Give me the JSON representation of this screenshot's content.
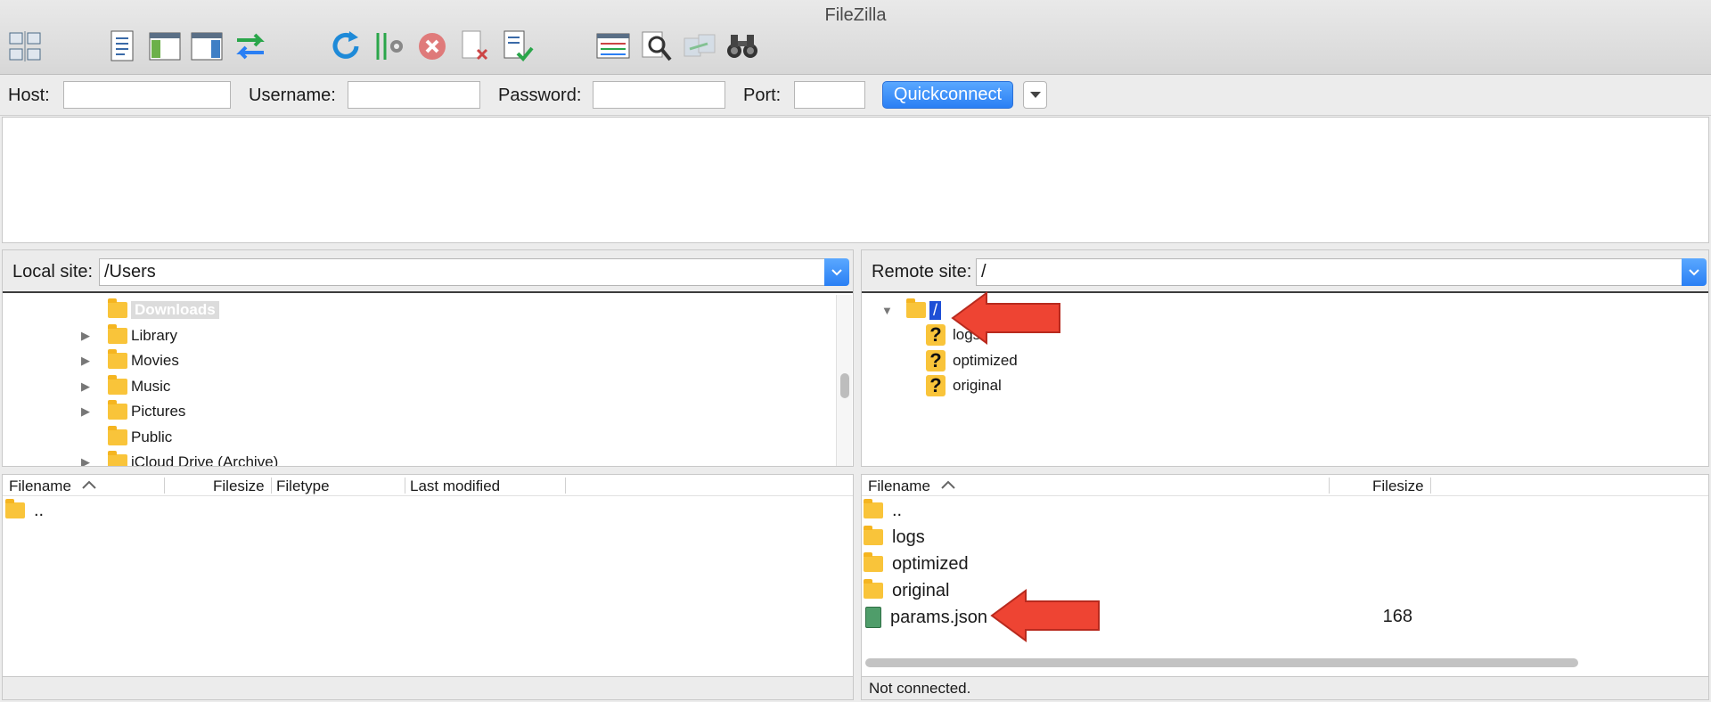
{
  "window": {
    "title": "FileZilla"
  },
  "toolbar": {
    "icons": [
      "site-manager-icon",
      "message-log-icon",
      "local-tree-icon",
      "remote-tree-icon",
      "transfer-queue-icon",
      "refresh-icon",
      "filter-settings-icon",
      "cancel-icon",
      "disconnect-icon",
      "reconnect-icon",
      "directory-listing-icon",
      "search-icon",
      "sync-browse-icon",
      "binoculars-icon"
    ]
  },
  "quickconnect": {
    "host_label": "Host:",
    "username_label": "Username:",
    "password_label": "Password:",
    "port_label": "Port:",
    "host_value": "",
    "username_value": "",
    "password_value": "",
    "port_value": "",
    "button_label": "Quickconnect"
  },
  "local": {
    "site_label": "Local site:",
    "path": "/Users",
    "tree": [
      {
        "name": "Downloads",
        "expandable": false,
        "selected": true
      },
      {
        "name": "Library",
        "expandable": true
      },
      {
        "name": "Movies",
        "expandable": true
      },
      {
        "name": "Music",
        "expandable": true
      },
      {
        "name": "Pictures",
        "expandable": true
      },
      {
        "name": "Public",
        "expandable": false
      },
      {
        "name": "iCloud Drive (Archive)",
        "expandable": true
      }
    ],
    "columns": {
      "filename": "Filename",
      "filesize": "Filesize",
      "filetype": "Filetype",
      "modified": "Last modified"
    },
    "files": [
      {
        "name": "..",
        "size": ""
      }
    ],
    "status": ""
  },
  "remote": {
    "site_label": "Remote site:",
    "path": "/",
    "tree_root": "/",
    "tree": [
      "logs",
      "optimized",
      "original"
    ],
    "columns": {
      "filename": "Filename",
      "filesize": "Filesize"
    },
    "files": [
      {
        "name": "..",
        "size": "",
        "type": "folder"
      },
      {
        "name": "logs",
        "size": "",
        "type": "folder"
      },
      {
        "name": "optimized",
        "size": "",
        "type": "folder"
      },
      {
        "name": "original",
        "size": "",
        "type": "folder"
      },
      {
        "name": "params.json",
        "size": "168",
        "type": "file"
      }
    ],
    "status": "Not connected."
  },
  "colors": {
    "accent": "#2a7ff4",
    "folder": "#f9c43a",
    "arrow": "#ee4433",
    "selection": "#1e4fd6"
  }
}
